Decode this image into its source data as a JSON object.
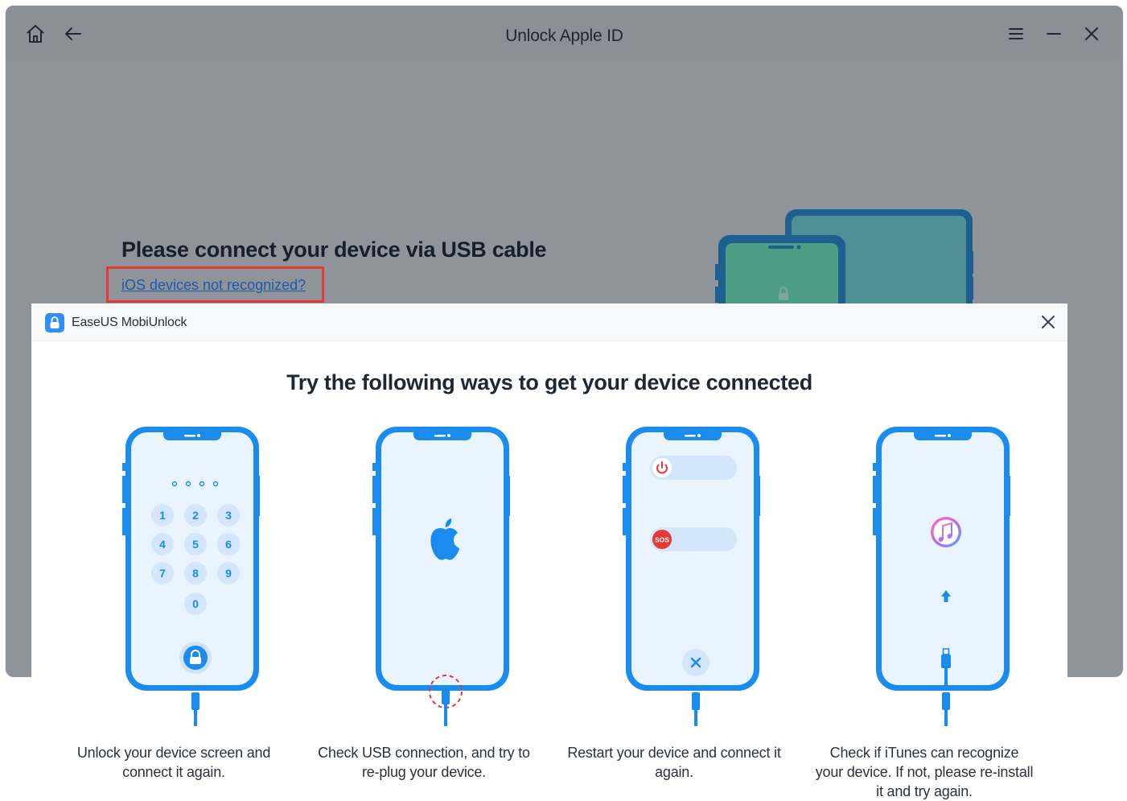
{
  "app": {
    "title": "Unlock Apple ID",
    "heading": "Please connect your device via USB cable",
    "help_link": "iOS devices not recognized?",
    "toolbar_icons": [
      "home-icon",
      "back-arrow-icon",
      "menu-icon",
      "minimize-icon",
      "close-icon"
    ]
  },
  "dialog": {
    "app_name": "EaseUS MobiUnlock",
    "title": "Try the following ways to get your device connected",
    "steps": [
      {
        "caption_line1": "Unlock your device screen and",
        "caption_line2": "connect it again.",
        "caption_line3": ""
      },
      {
        "caption_line1": "Check USB connection, and try to",
        "caption_line2": "re-plug your device.",
        "caption_line3": ""
      },
      {
        "caption_line1": "Restart your device and connect it",
        "caption_line2": "again.",
        "caption_line3": ""
      },
      {
        "caption_line1": "Check if iTunes can recognize",
        "caption_line2": "your device. If not, please re-install",
        "caption_line3": "it and try again."
      }
    ],
    "keypad": [
      "1",
      "2",
      "3",
      "4",
      "5",
      "6",
      "7",
      "8",
      "9",
      "0"
    ],
    "sos_label": "SOS"
  },
  "colors": {
    "phone_blue": "#1a8cf0",
    "screen_bg": "#eaf4fe",
    "highlight_red": "#e53935",
    "dim_overlay": "#8e949a"
  }
}
